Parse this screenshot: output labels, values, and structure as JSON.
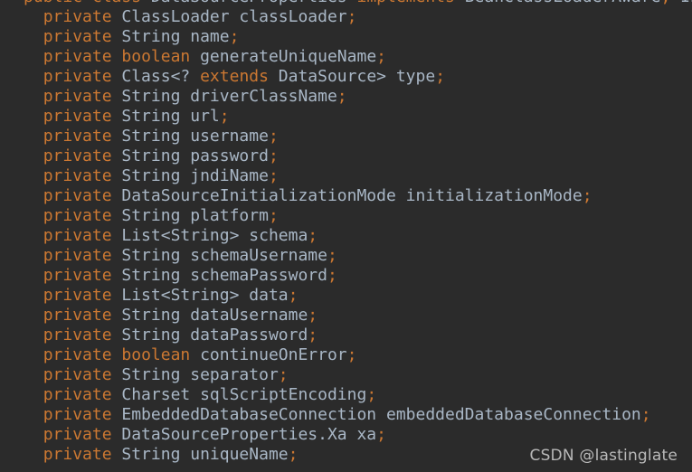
{
  "editor": {
    "theme_name": "darcula",
    "background_color": "#2b2b2b",
    "keyword_color": "#cc7832",
    "identifier_color": "#a9b7c6",
    "punctuation_color": "#cc7832",
    "language": "java",
    "lines": [
      {
        "id": "line-class-declaration",
        "clipped": true,
        "tokens": [
          {
            "t": "public",
            "c": "kw"
          },
          {
            "t": " ",
            "c": "plain"
          },
          {
            "t": "class",
            "c": "kw"
          },
          {
            "t": " DataSourceProperties ",
            "c": "id"
          },
          {
            "t": "implements",
            "c": "kw"
          },
          {
            "t": " BeanClassLoaderAware",
            "c": "id"
          },
          {
            "t": ",",
            "c": "punc"
          },
          {
            "t": " Init",
            "c": "id"
          }
        ]
      },
      {
        "id": "line-classloader",
        "clipped": false,
        "tokens": [
          {
            "t": "  ",
            "c": "plain"
          },
          {
            "t": "private",
            "c": "kw"
          },
          {
            "t": " ClassLoader classLoader",
            "c": "id"
          },
          {
            "t": ";",
            "c": "punc"
          }
        ]
      },
      {
        "id": "line-name",
        "clipped": false,
        "tokens": [
          {
            "t": "  ",
            "c": "plain"
          },
          {
            "t": "private",
            "c": "kw"
          },
          {
            "t": " String name",
            "c": "id"
          },
          {
            "t": ";",
            "c": "punc"
          }
        ]
      },
      {
        "id": "line-generate-unique-name",
        "clipped": false,
        "tokens": [
          {
            "t": "  ",
            "c": "plain"
          },
          {
            "t": "private",
            "c": "kw"
          },
          {
            "t": " ",
            "c": "plain"
          },
          {
            "t": "boolean",
            "c": "kw"
          },
          {
            "t": " generateUniqueName",
            "c": "id"
          },
          {
            "t": ";",
            "c": "punc"
          }
        ]
      },
      {
        "id": "line-type",
        "clipped": false,
        "tokens": [
          {
            "t": "  ",
            "c": "plain"
          },
          {
            "t": "private",
            "c": "kw"
          },
          {
            "t": " Class<? ",
            "c": "id"
          },
          {
            "t": "extends",
            "c": "kw"
          },
          {
            "t": " DataSource> type",
            "c": "id"
          },
          {
            "t": ";",
            "c": "punc"
          }
        ]
      },
      {
        "id": "line-driver-class-name",
        "clipped": false,
        "tokens": [
          {
            "t": "  ",
            "c": "plain"
          },
          {
            "t": "private",
            "c": "kw"
          },
          {
            "t": " String driverClassName",
            "c": "id"
          },
          {
            "t": ";",
            "c": "punc"
          }
        ]
      },
      {
        "id": "line-url",
        "clipped": false,
        "tokens": [
          {
            "t": "  ",
            "c": "plain"
          },
          {
            "t": "private",
            "c": "kw"
          },
          {
            "t": " String url",
            "c": "id"
          },
          {
            "t": ";",
            "c": "punc"
          }
        ]
      },
      {
        "id": "line-username",
        "clipped": false,
        "tokens": [
          {
            "t": "  ",
            "c": "plain"
          },
          {
            "t": "private",
            "c": "kw"
          },
          {
            "t": " String username",
            "c": "id"
          },
          {
            "t": ";",
            "c": "punc"
          }
        ]
      },
      {
        "id": "line-password",
        "clipped": false,
        "tokens": [
          {
            "t": "  ",
            "c": "plain"
          },
          {
            "t": "private",
            "c": "kw"
          },
          {
            "t": " String password",
            "c": "id"
          },
          {
            "t": ";",
            "c": "punc"
          }
        ]
      },
      {
        "id": "line-jndi-name",
        "clipped": false,
        "tokens": [
          {
            "t": "  ",
            "c": "plain"
          },
          {
            "t": "private",
            "c": "kw"
          },
          {
            "t": " String jndiName",
            "c": "id"
          },
          {
            "t": ";",
            "c": "punc"
          }
        ]
      },
      {
        "id": "line-initialization-mode",
        "clipped": false,
        "tokens": [
          {
            "t": "  ",
            "c": "plain"
          },
          {
            "t": "private",
            "c": "kw"
          },
          {
            "t": " DataSourceInitializationMode initializationMode",
            "c": "id"
          },
          {
            "t": ";",
            "c": "punc"
          }
        ]
      },
      {
        "id": "line-platform",
        "clipped": false,
        "tokens": [
          {
            "t": "  ",
            "c": "plain"
          },
          {
            "t": "private",
            "c": "kw"
          },
          {
            "t": " String platform",
            "c": "id"
          },
          {
            "t": ";",
            "c": "punc"
          }
        ]
      },
      {
        "id": "line-schema",
        "clipped": false,
        "tokens": [
          {
            "t": "  ",
            "c": "plain"
          },
          {
            "t": "private",
            "c": "kw"
          },
          {
            "t": " List<String> schema",
            "c": "id"
          },
          {
            "t": ";",
            "c": "punc"
          }
        ]
      },
      {
        "id": "line-schema-username",
        "clipped": false,
        "tokens": [
          {
            "t": "  ",
            "c": "plain"
          },
          {
            "t": "private",
            "c": "kw"
          },
          {
            "t": " String schemaUsername",
            "c": "id"
          },
          {
            "t": ";",
            "c": "punc"
          }
        ]
      },
      {
        "id": "line-schema-password",
        "clipped": false,
        "tokens": [
          {
            "t": "  ",
            "c": "plain"
          },
          {
            "t": "private",
            "c": "kw"
          },
          {
            "t": " String schemaPassword",
            "c": "id"
          },
          {
            "t": ";",
            "c": "punc"
          }
        ]
      },
      {
        "id": "line-data",
        "clipped": false,
        "tokens": [
          {
            "t": "  ",
            "c": "plain"
          },
          {
            "t": "private",
            "c": "kw"
          },
          {
            "t": " List<String> data",
            "c": "id"
          },
          {
            "t": ";",
            "c": "punc"
          }
        ]
      },
      {
        "id": "line-data-username",
        "clipped": false,
        "tokens": [
          {
            "t": "  ",
            "c": "plain"
          },
          {
            "t": "private",
            "c": "kw"
          },
          {
            "t": " String dataUsername",
            "c": "id"
          },
          {
            "t": ";",
            "c": "punc"
          }
        ]
      },
      {
        "id": "line-data-password",
        "clipped": false,
        "tokens": [
          {
            "t": "  ",
            "c": "plain"
          },
          {
            "t": "private",
            "c": "kw"
          },
          {
            "t": " String dataPassword",
            "c": "id"
          },
          {
            "t": ";",
            "c": "punc"
          }
        ]
      },
      {
        "id": "line-continue-on-error",
        "clipped": false,
        "tokens": [
          {
            "t": "  ",
            "c": "plain"
          },
          {
            "t": "private",
            "c": "kw"
          },
          {
            "t": " ",
            "c": "plain"
          },
          {
            "t": "boolean",
            "c": "kw"
          },
          {
            "t": " continueOnError",
            "c": "id"
          },
          {
            "t": ";",
            "c": "punc"
          }
        ]
      },
      {
        "id": "line-separator",
        "clipped": false,
        "tokens": [
          {
            "t": "  ",
            "c": "plain"
          },
          {
            "t": "private",
            "c": "kw"
          },
          {
            "t": " String separator",
            "c": "id"
          },
          {
            "t": ";",
            "c": "punc"
          }
        ]
      },
      {
        "id": "line-sql-script-encoding",
        "clipped": false,
        "tokens": [
          {
            "t": "  ",
            "c": "plain"
          },
          {
            "t": "private",
            "c": "kw"
          },
          {
            "t": " Charset sqlScriptEncoding",
            "c": "id"
          },
          {
            "t": ";",
            "c": "punc"
          }
        ]
      },
      {
        "id": "line-embedded-database-connection",
        "clipped": false,
        "tokens": [
          {
            "t": "  ",
            "c": "plain"
          },
          {
            "t": "private",
            "c": "kw"
          },
          {
            "t": " EmbeddedDatabaseConnection embeddedDatabaseConnection",
            "c": "id"
          },
          {
            "t": ";",
            "c": "punc"
          }
        ]
      },
      {
        "id": "line-xa",
        "clipped": false,
        "tokens": [
          {
            "t": "  ",
            "c": "plain"
          },
          {
            "t": "private",
            "c": "kw"
          },
          {
            "t": " DataSourceProperties.Xa xa",
            "c": "id"
          },
          {
            "t": ";",
            "c": "punc"
          }
        ]
      },
      {
        "id": "line-unique-name",
        "clipped": false,
        "tokens": [
          {
            "t": "  ",
            "c": "plain"
          },
          {
            "t": "private",
            "c": "kw"
          },
          {
            "t": " String uniqueName",
            "c": "id"
          },
          {
            "t": ";",
            "c": "punc"
          }
        ]
      }
    ]
  },
  "watermark": {
    "text": "CSDN @lastinglate",
    "color": "#b9b9b9"
  }
}
